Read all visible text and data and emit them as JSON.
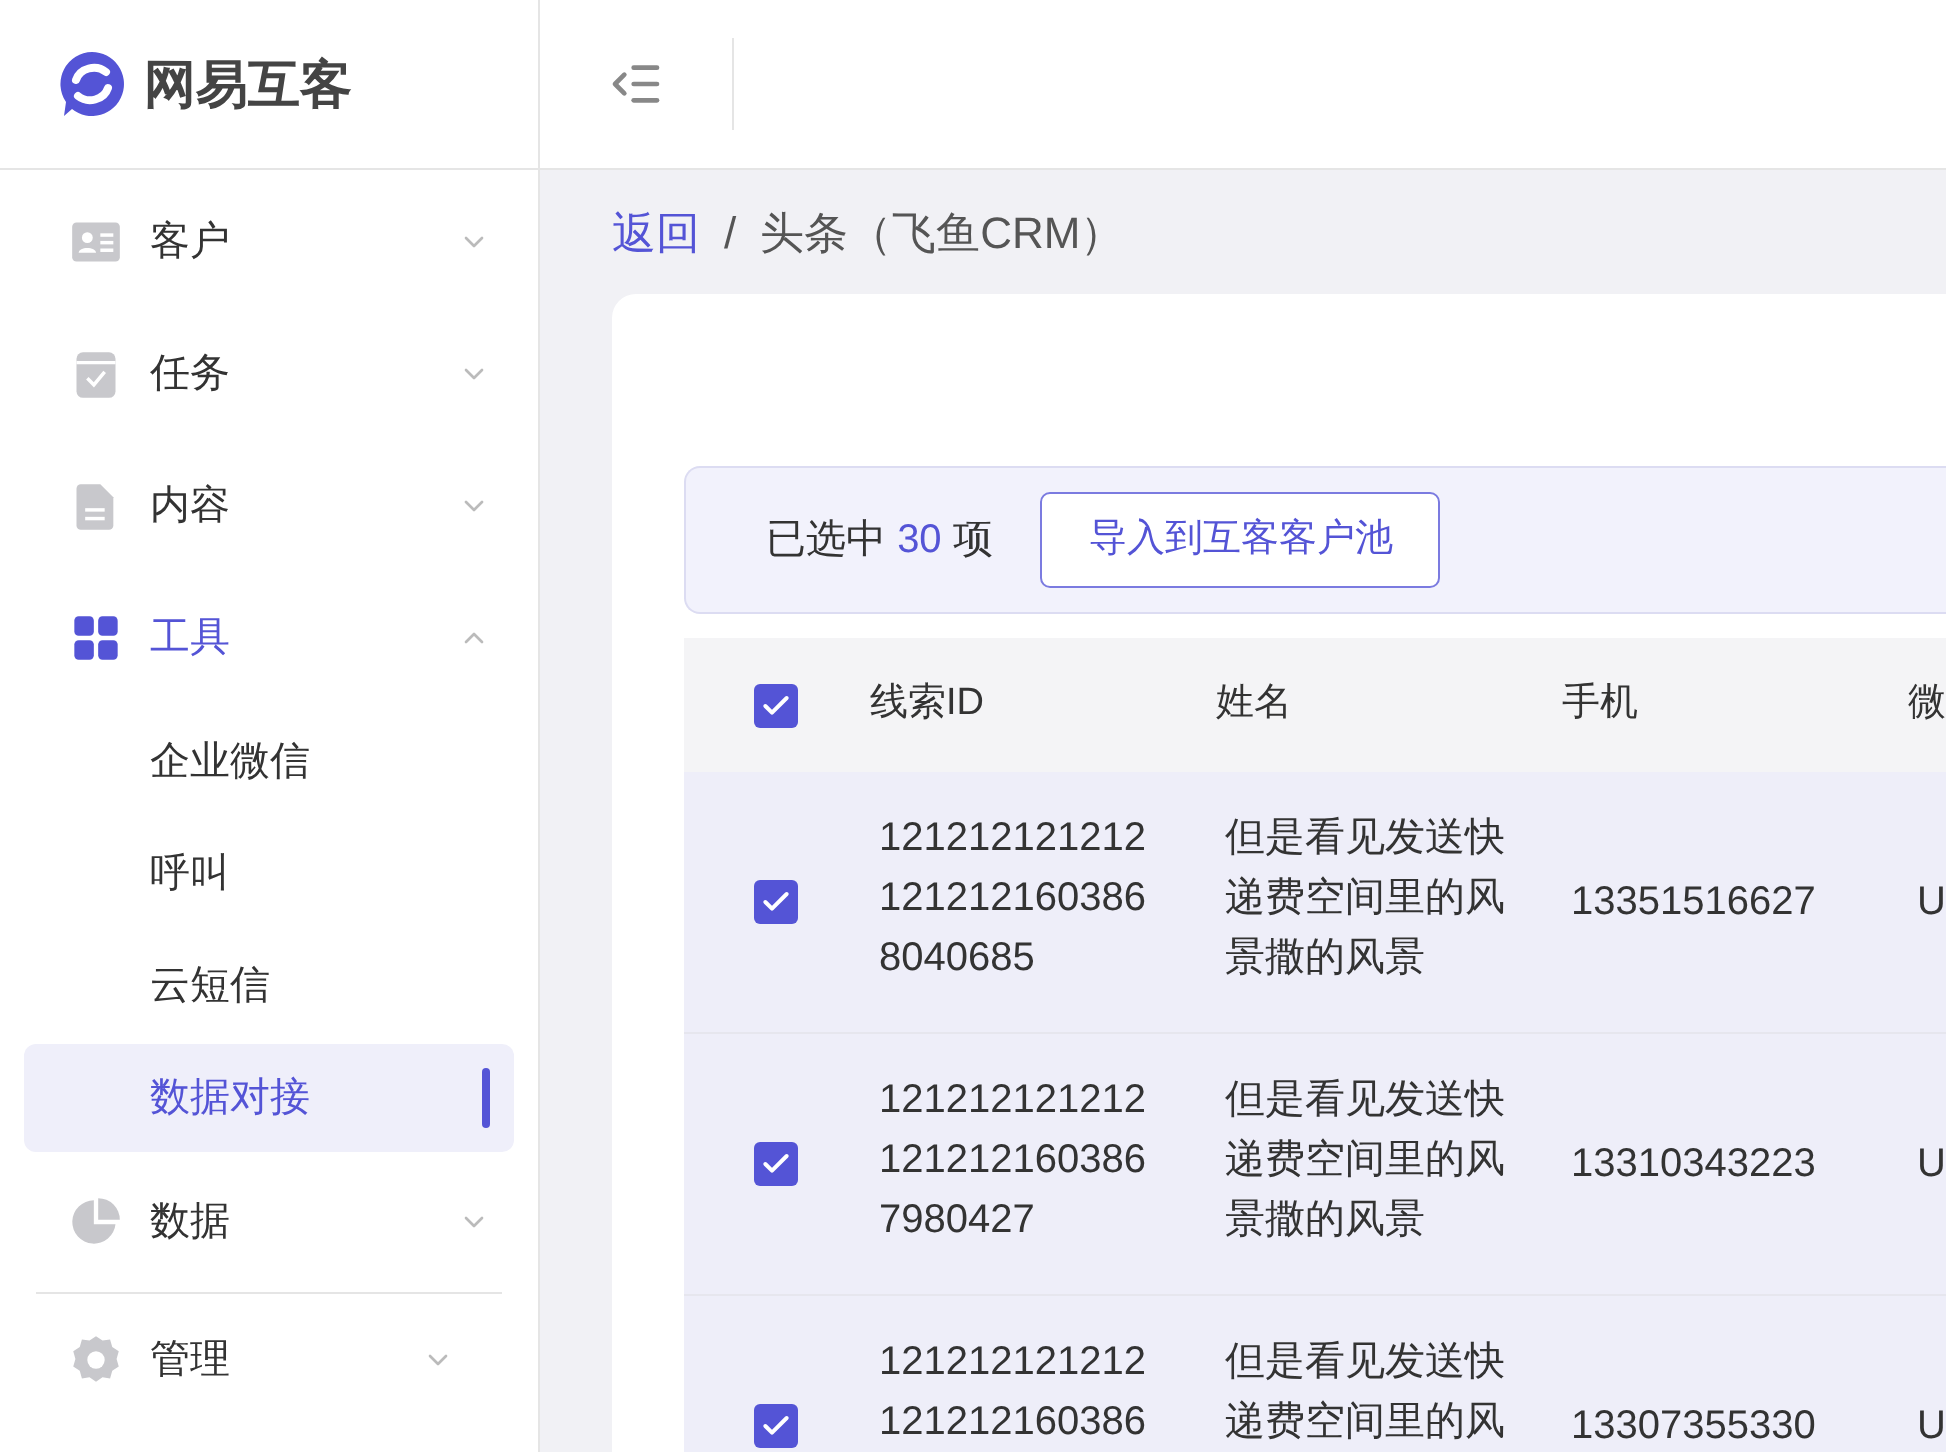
{
  "logo": {
    "text": "网易互客"
  },
  "sidebar": {
    "items": [
      {
        "label": "客户",
        "expanded": false,
        "selected": false
      },
      {
        "label": "任务",
        "expanded": false,
        "selected": false
      },
      {
        "label": "内容",
        "expanded": false,
        "selected": false
      },
      {
        "label": "工具",
        "expanded": true,
        "selected": true,
        "children": [
          {
            "label": "企业微信",
            "selected": false
          },
          {
            "label": "呼叫",
            "selected": false
          },
          {
            "label": "云短信",
            "selected": false
          },
          {
            "label": "数据对接",
            "selected": true
          }
        ]
      },
      {
        "label": "数据",
        "expanded": false,
        "selected": false
      },
      {
        "label": "管理",
        "expanded": false,
        "selected": false
      }
    ]
  },
  "breadcrumb": {
    "back": "返回",
    "separator": "/",
    "current": "头条（飞鱼CRM）"
  },
  "selection_bar": {
    "prefix": "已选中",
    "count": "30",
    "suffix": "项",
    "import_button": "导入到互客客户池"
  },
  "table": {
    "all_checked": true,
    "columns": [
      "线索ID",
      "姓名",
      "手机",
      "微"
    ],
    "rows": [
      {
        "checked": true,
        "cells": [
          "1212121212121212121603868040685",
          "但是看见发送快递费空间里的风景撒的风景",
          "13351516627",
          "U"
        ]
      },
      {
        "checked": true,
        "cells": [
          "1212121212121212121603867980427",
          "但是看见发送快递费空间里的风景撒的风景",
          "13310343223",
          "U"
        ]
      },
      {
        "checked": true,
        "cells": [
          "121212121212121212160386",
          "但是看见发送快递费空间里的风",
          "13307355330",
          "U"
        ]
      }
    ]
  }
}
